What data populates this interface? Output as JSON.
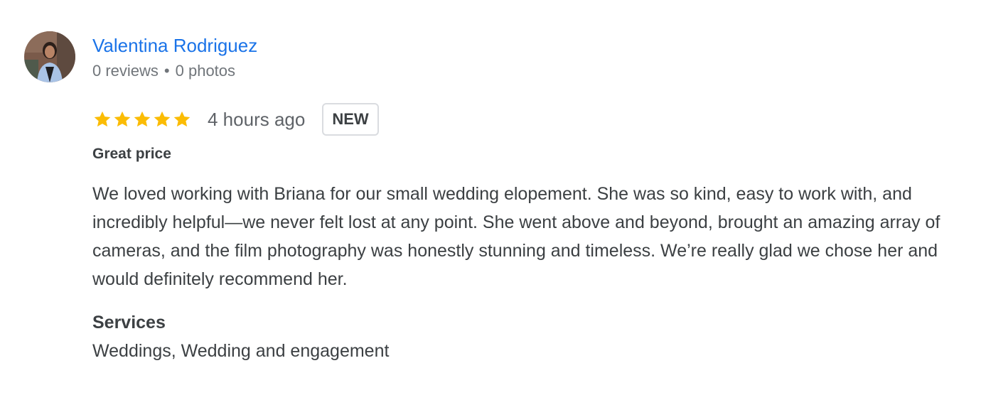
{
  "reviewer": {
    "name": "Valentina Rodriguez",
    "reviews": "0 reviews",
    "separator": "•",
    "photos": "0 photos"
  },
  "rating": {
    "stars": 5,
    "max_stars": 5,
    "star_color": "#fbbc04",
    "time_ago": "4 hours ago",
    "badge": "NEW"
  },
  "review": {
    "headline": "Great price",
    "body": "We loved working with Briana for our small wedding elopement. She was so kind, easy to work with, and incredibly helpful—we never felt lost at any point. She went above and beyond, brought an amazing array of cameras, and the film photography was honestly stunning and timeless. We’re really glad we chose her and would definitely recommend her."
  },
  "services": {
    "title": "Services",
    "list": "Weddings, Wedding and engagement"
  },
  "colors": {
    "name_link": "#1a73e8",
    "meta_text": "#70757a",
    "body_text": "#3c4043",
    "badge_border": "#dadce0"
  },
  "icons": {
    "avatar": "user-photo-avatar",
    "star": "star-icon",
    "more": "more-options-icon"
  }
}
